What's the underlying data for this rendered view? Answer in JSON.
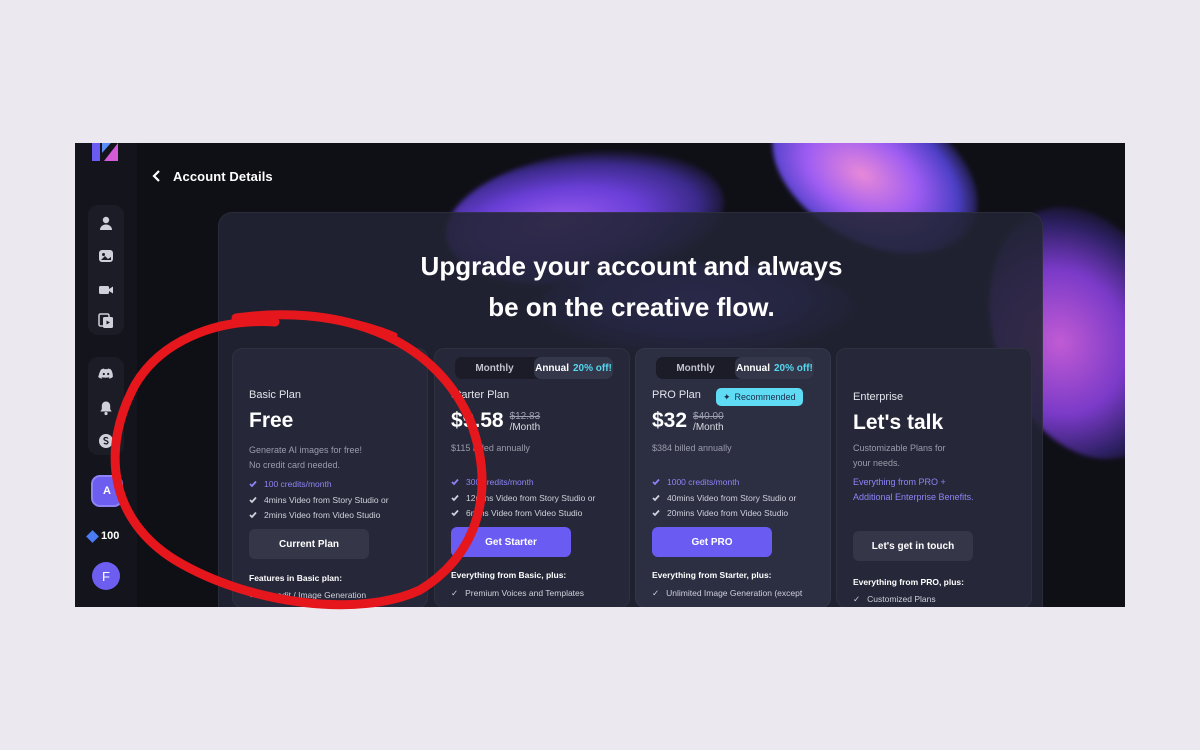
{
  "header": {
    "title": "Account Details"
  },
  "headline": {
    "line1": "Upgrade your account and always",
    "line2": "be on the creative flow."
  },
  "sidebar": {
    "items": [
      {
        "icon": "user-icon"
      },
      {
        "icon": "image-studio-icon"
      },
      {
        "icon": "video-icon"
      },
      {
        "icon": "story-icon"
      },
      {
        "icon": "discord-icon"
      },
      {
        "icon": "bell-icon"
      },
      {
        "icon": "billing-icon"
      }
    ],
    "active_label": "A",
    "credits": "100",
    "avatar": "F"
  },
  "toggle": {
    "monthly": "Monthly",
    "annual": "Annual",
    "discount": "20% off!"
  },
  "plans": [
    {
      "name": "Basic Plan",
      "price": "Free",
      "desc1": "Generate AI images for free!",
      "desc2": "No credit card needed.",
      "features": [
        "100 credits/month",
        "4mins Video from Story Studio or",
        "2mins Video from Video Studio"
      ],
      "cta": "Current Plan",
      "section": "Features in Basic plan:",
      "sub": "1 credit / Image Generation"
    },
    {
      "name": "Starter Plan",
      "price": "$9.58",
      "strike": "$12.83",
      "per": "/Month",
      "billed": "$115 billed annually",
      "features": [
        "300 credits/month",
        "12mins Video from Story Studio or",
        "6mins Video from Video Studio"
      ],
      "cta": "Get Starter",
      "section": "Everything from Basic, plus:",
      "sub": "Premium Voices and Templates"
    },
    {
      "name": "PRO Plan",
      "badge": "Recommended",
      "price": "$32",
      "strike": "$40.00",
      "per": "/Month",
      "billed": "$384 billed annually",
      "features": [
        "1000 credits/month",
        "40mins Video from Story Studio or",
        "20mins Video from Video Studio"
      ],
      "cta": "Get PRO",
      "section": "Everything from Starter, plus:",
      "sub": "Unlimited Image Generation (except"
    },
    {
      "name": "Enterprise",
      "price": "Let's talk",
      "desc1": "Customizable Plans for",
      "desc2": "your needs.",
      "link1": "Everything from PRO +",
      "link2": "Additional Enterprise Benefits.",
      "cta": "Let's get in touch",
      "section": "Everything from PRO, plus:",
      "sub": "Customized Plans"
    }
  ],
  "colors": {
    "accent": "#6a5bf2",
    "discount": "#53d8f0",
    "annotation": "#e5161c"
  }
}
